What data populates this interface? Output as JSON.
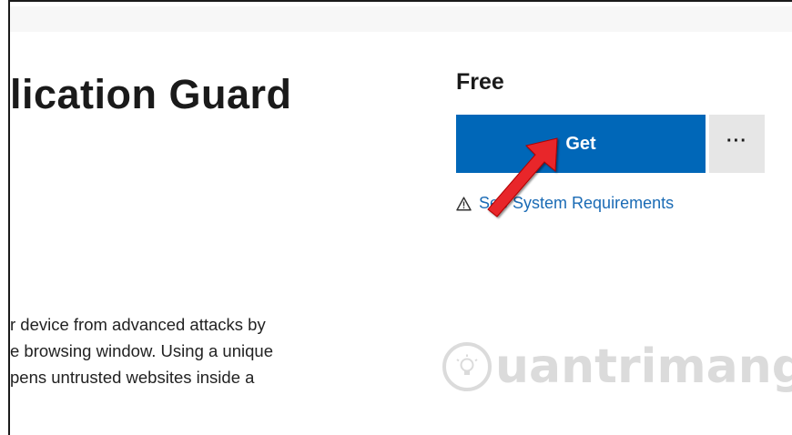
{
  "app": {
    "title": "lication Guard"
  },
  "description": {
    "lines": [
      "r device from advanced attacks by",
      "e browsing window. Using a unique",
      "pens untrusted websites inside a"
    ]
  },
  "purchase": {
    "price": "Free",
    "get_label": "Get",
    "more_label": "···",
    "system_requirements_label": "See System Requirements"
  },
  "icons": {
    "warning": "warning-triangle-icon",
    "more": "ellipsis-icon",
    "annotation_arrow": "red-arrow-icon",
    "watermark_logo": "lightbulb-icon"
  },
  "colors": {
    "accent": "#0067b8",
    "link": "#1a6bb5",
    "more_button_bg": "#e6e6e6",
    "annotation_arrow": "#e8262a"
  },
  "watermark": {
    "text": "uantrimang"
  }
}
